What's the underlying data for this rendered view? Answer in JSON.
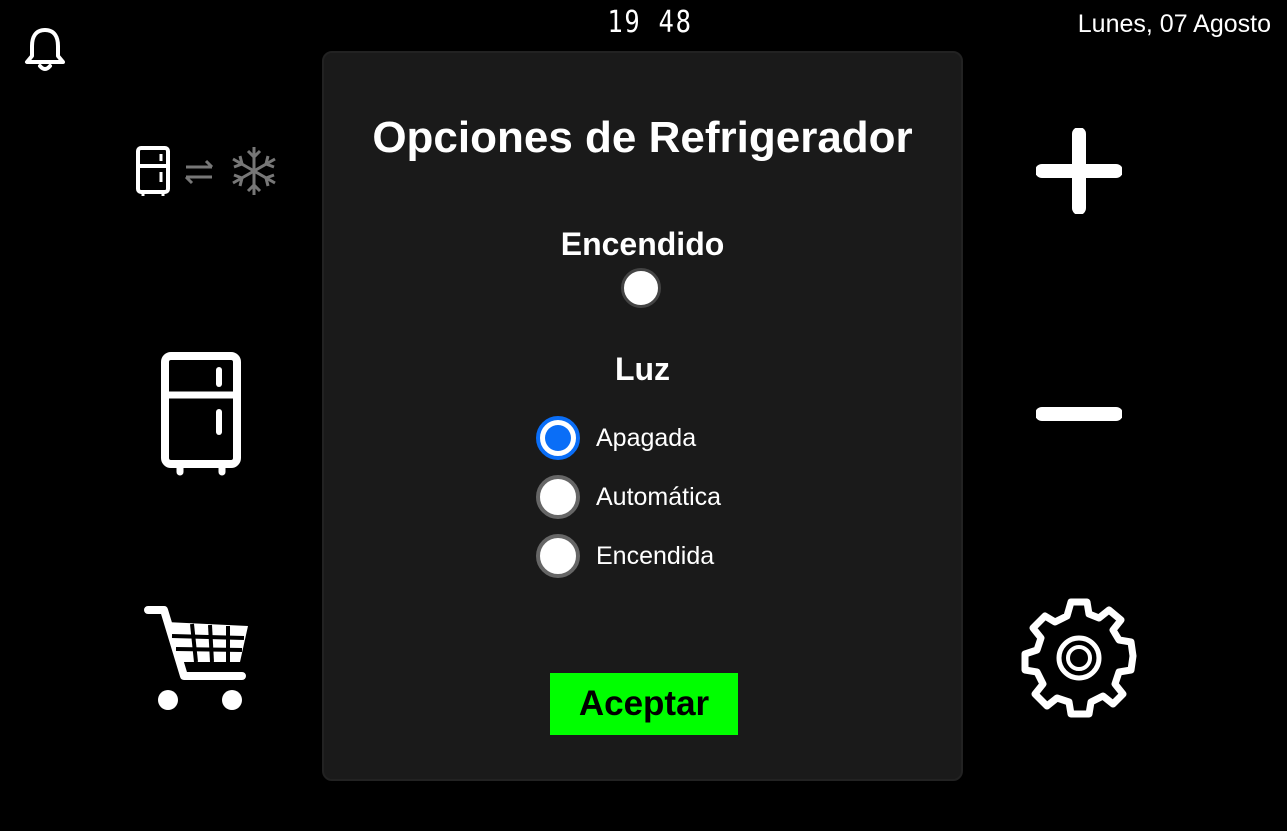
{
  "status_bar": {
    "time": "19 48",
    "date": "Lunes, 07 Agosto"
  },
  "icons": {
    "notifications": "bell-icon",
    "fridge_freezer_swap": "fridge-swap-freezer-icon",
    "fridge": "fridge-icon",
    "shopping": "shopping-cart-icon",
    "increase": "plus-icon",
    "decrease": "minus-icon",
    "settings": "gear-icon"
  },
  "dialog": {
    "title": "Opciones de Refrigerador",
    "power": {
      "label": "Encendido",
      "state": "off"
    },
    "light": {
      "label": "Luz",
      "options": [
        {
          "label": "Apagada",
          "selected": true
        },
        {
          "label": "Automática",
          "selected": false
        },
        {
          "label": "Encendida",
          "selected": false
        }
      ]
    },
    "accept_label": "Aceptar"
  },
  "colors": {
    "background": "#000000",
    "panel": "#1a1a1a",
    "accent": "#0a6ef7",
    "accept_button": "#00ff00"
  }
}
